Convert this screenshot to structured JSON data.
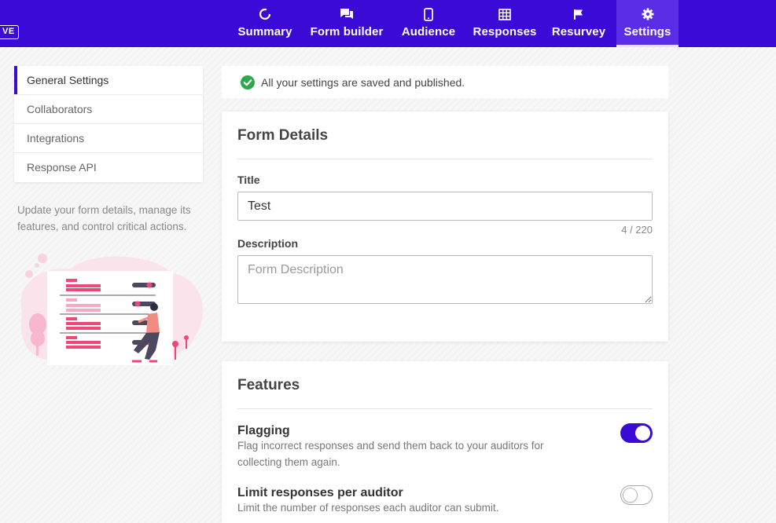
{
  "header": {
    "badge": "VE",
    "accent_color": "#3c0ad6",
    "tabs": [
      {
        "label": "Summary",
        "icon": "pie-chart-icon",
        "active": false
      },
      {
        "label": "Form builder",
        "icon": "chat-bubbles-icon",
        "active": false
      },
      {
        "label": "Audience",
        "icon": "mobile-phone-icon",
        "active": false
      },
      {
        "label": "Responses",
        "icon": "table-grid-icon",
        "active": false
      },
      {
        "label": "Resurvey",
        "icon": "flag-icon",
        "active": false
      },
      {
        "label": "Settings",
        "icon": "gear-icon",
        "active": true
      }
    ]
  },
  "sidebar": {
    "items": [
      {
        "label": "General Settings",
        "active": true
      },
      {
        "label": "Collaborators",
        "active": false
      },
      {
        "label": "Integrations",
        "active": false
      },
      {
        "label": "Response API",
        "active": false
      }
    ],
    "description": "Update your form details, manage its features, and control critical actions."
  },
  "status": {
    "message": "All your settings are saved and published.",
    "icon": "check-circle-icon",
    "color": "#2ea84a"
  },
  "form_details": {
    "heading": "Form Details",
    "title_label": "Title",
    "title_value": "Test",
    "title_count": "4 / 220",
    "description_label": "Description",
    "description_placeholder": "Form Description"
  },
  "features": {
    "heading": "Features",
    "items": [
      {
        "title": "Flagging",
        "description": "Flag incorrect responses and send them back to your auditors for collecting them again.",
        "enabled": true
      },
      {
        "title": "Limit responses per auditor",
        "description": "Limit the number of responses each auditor can submit.",
        "enabled": false
      }
    ]
  }
}
